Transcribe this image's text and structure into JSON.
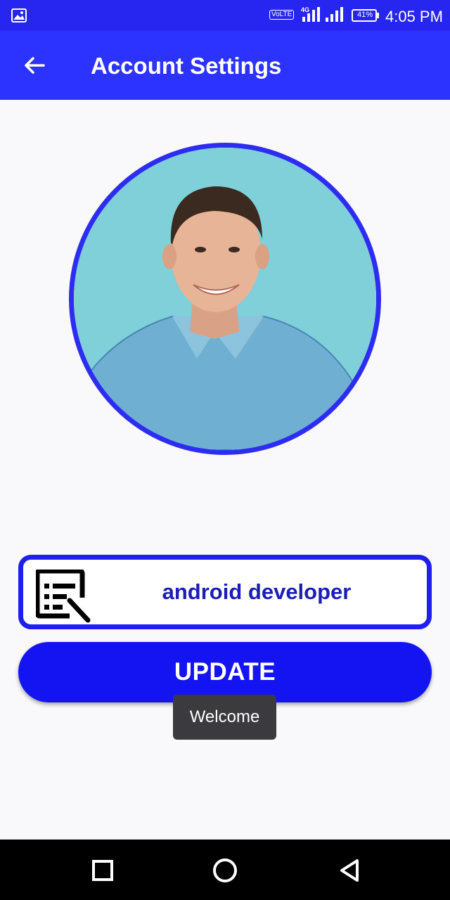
{
  "status_bar": {
    "volte": "VoLTE",
    "network": "4G",
    "battery": "41%",
    "time": "4:05 PM"
  },
  "app_bar": {
    "title": "Account Settings",
    "back_icon": "arrow-back-icon"
  },
  "profile": {
    "avatar_icon": "profile-photo",
    "border_color": "#2d2df2"
  },
  "field": {
    "icon": "document-edit-icon",
    "value": "android developer"
  },
  "actions": {
    "update_label": "UPDATE"
  },
  "toast": {
    "text": "Welcome"
  },
  "nav_bar": {
    "recents_icon": "square-icon",
    "home_icon": "circle-icon",
    "back_icon": "triangle-back-icon"
  },
  "colors": {
    "primary": "#2d33ff",
    "button": "#1414f2",
    "text_blue": "#1c1cb8"
  }
}
